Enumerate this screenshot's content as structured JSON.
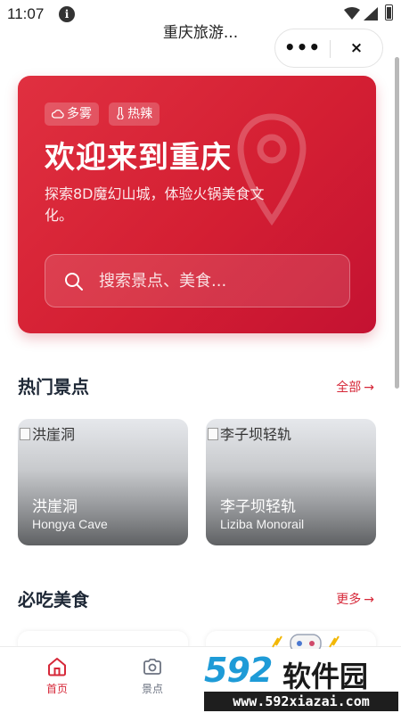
{
  "status_bar": {
    "time": "11:07"
  },
  "header": {
    "title": "重庆旅游...",
    "more_label": "•••",
    "close_label": "×"
  },
  "hero": {
    "tags": [
      {
        "icon": "cloud-icon",
        "label": "多雾"
      },
      {
        "icon": "thermometer-icon",
        "label": "热辣"
      }
    ],
    "title": "欢迎来到重庆",
    "description": "探索8D魔幻山城，体验火锅美食文化。",
    "search": {
      "placeholder": "搜索景点、美食..."
    }
  },
  "popular_spots": {
    "title": "热门景点",
    "link_label": "全部",
    "items": [
      {
        "image_alt": "洪崖洞",
        "name": "洪崖洞",
        "name_en": "Hongya Cave"
      },
      {
        "image_alt": "李子坝轻轨",
        "name": "李子坝轻轨",
        "name_en": "Liziba Monorail"
      }
    ]
  },
  "must_eat": {
    "title": "必吃美食",
    "link_label": "更多"
  },
  "bottom_nav": [
    {
      "icon": "home-icon",
      "label": "首页",
      "active": true
    },
    {
      "icon": "camera-icon",
      "label": "景点",
      "active": false
    }
  ],
  "watermark": {
    "brand_number": "592",
    "brand_name": "软件园",
    "url": "www.592xiazai.com"
  },
  "colors": {
    "accent": "#d62839",
    "hero_start": "#e03040",
    "hero_end": "#c41232",
    "watermark_blue": "#1e9bd7"
  }
}
